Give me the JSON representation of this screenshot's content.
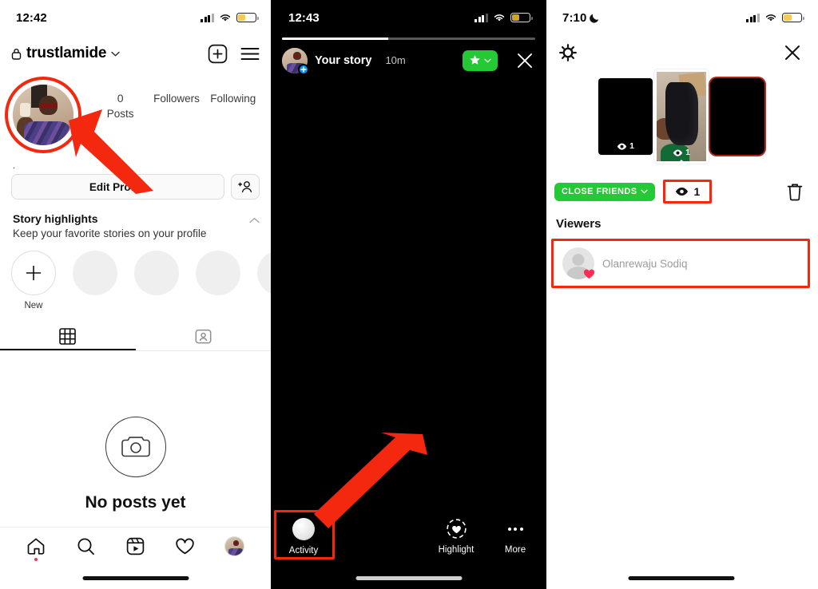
{
  "panels": {
    "profile": {
      "status": {
        "time": "12:42",
        "signal_icon": "cellular-signal-icon",
        "wifi_icon": "wifi-icon",
        "battery_icon": "battery-low-icon"
      },
      "header": {
        "lock_icon": "lock-icon",
        "username": "trustlamide",
        "chevron_icon": "chevron-down-icon",
        "add_icon": "plus-box-icon",
        "menu_icon": "hamburger-menu-icon"
      },
      "avatar_name": "profile-avatar",
      "stats": [
        {
          "number": "0",
          "label": "Posts"
        },
        {
          "number": "",
          "label": "Followers"
        },
        {
          "number": "",
          "label": "Following"
        }
      ],
      "bio": ".",
      "actions": {
        "edit_profile": "Edit Profile",
        "add_person_icon": "add-person-icon"
      },
      "highlights": {
        "title": "Story highlights",
        "subtitle": "Keep your favorite stories on your profile",
        "collapse_icon": "chevron-up-icon",
        "new_label": "New",
        "placeholder_count": 4
      },
      "tabs": [
        {
          "icon": "grid-icon",
          "name": "tab-grid",
          "active": true
        },
        {
          "icon": "tagged-person-icon",
          "name": "tab-tagged",
          "active": false
        }
      ],
      "empty_state": {
        "icon": "camera-circle-icon",
        "text": "No posts yet"
      },
      "tabbar": [
        {
          "icon": "home-icon",
          "name": "nav-home",
          "badge": true
        },
        {
          "icon": "search-icon",
          "name": "nav-search",
          "badge": false
        },
        {
          "icon": "reels-icon",
          "name": "nav-reels",
          "badge": false
        },
        {
          "icon": "heart-icon",
          "name": "nav-activity",
          "badge": false
        },
        {
          "icon": "avatar-icon",
          "name": "nav-profile",
          "badge": false
        }
      ]
    },
    "story": {
      "status": {
        "time": "12:43",
        "signal_icon": "cellular-signal-icon",
        "wifi_icon": "wifi-icon",
        "battery_icon": "battery-low-icon"
      },
      "progress_percent": 42,
      "header": {
        "avatar_name": "story-author-avatar",
        "avatar_badge_icon": "plus-badge-icon",
        "title": "Your story",
        "time": "10m",
        "close_friends_icon": "star-icon",
        "close_friends_chevron_icon": "chevron-down-icon",
        "close_icon": "close-x-icon"
      },
      "bottom": [
        {
          "label": "Activity",
          "icon": "activity-circle-icon",
          "name": "story-activity-button",
          "highlighted": true
        },
        {
          "label": "Highlight",
          "icon": "highlight-ring-heart-icon",
          "name": "story-highlight-button",
          "highlighted": false
        },
        {
          "label": "More",
          "icon": "more-dots-icon",
          "name": "story-more-button",
          "highlighted": false
        }
      ]
    },
    "insights": {
      "status": {
        "time": "7:10",
        "moon_icon": "moon-icon",
        "signal_icon": "cellular-signal-icon",
        "wifi_icon": "wifi-icon",
        "battery_icon": "battery-low-icon"
      },
      "header": {
        "sun_icon": "brightness-sun-icon",
        "close_icon": "close-x-icon"
      },
      "thumbnails": [
        {
          "name": "story-thumb-prev",
          "views": "1",
          "eye_icon": "eye-icon",
          "active": false
        },
        {
          "name": "story-thumb-current",
          "views": "1",
          "eye_icon": "eye-icon",
          "active": true
        },
        {
          "name": "story-thumb-next",
          "views": "",
          "eye_icon": "eye-icon",
          "active": false
        }
      ],
      "bar": {
        "close_friends_label": "CLOSE FRIENDS",
        "close_friends_chevron_icon": "chevron-down-icon",
        "views_icon": "eye-icon",
        "views_count": "1",
        "delete_icon": "trash-icon"
      },
      "viewers_title": "Viewers",
      "viewers": [
        {
          "name": "Olanrewaju Sodiq",
          "avatar_icon": "default-avatar-icon",
          "liked_icon": "heart-badge-icon",
          "send_icon": "send-message-icon"
        }
      ]
    }
  },
  "annotations": {
    "accent_color": "#f4280f",
    "arrows": [
      {
        "name": "arrow-to-profile-avatar"
      },
      {
        "name": "arrow-to-activity-button"
      }
    ],
    "boxes": [
      {
        "name": "highlight-box-views-count"
      },
      {
        "name": "highlight-box-viewer-row"
      },
      {
        "name": "highlight-box-activity-button"
      },
      {
        "name": "highlight-ring-profile-avatar"
      }
    ]
  },
  "colors": {
    "close_friends_green": "#25c935",
    "annotation_red": "#f4280f",
    "instagram_blue": "#0095f6",
    "battery_yellow": "#f4c430"
  }
}
